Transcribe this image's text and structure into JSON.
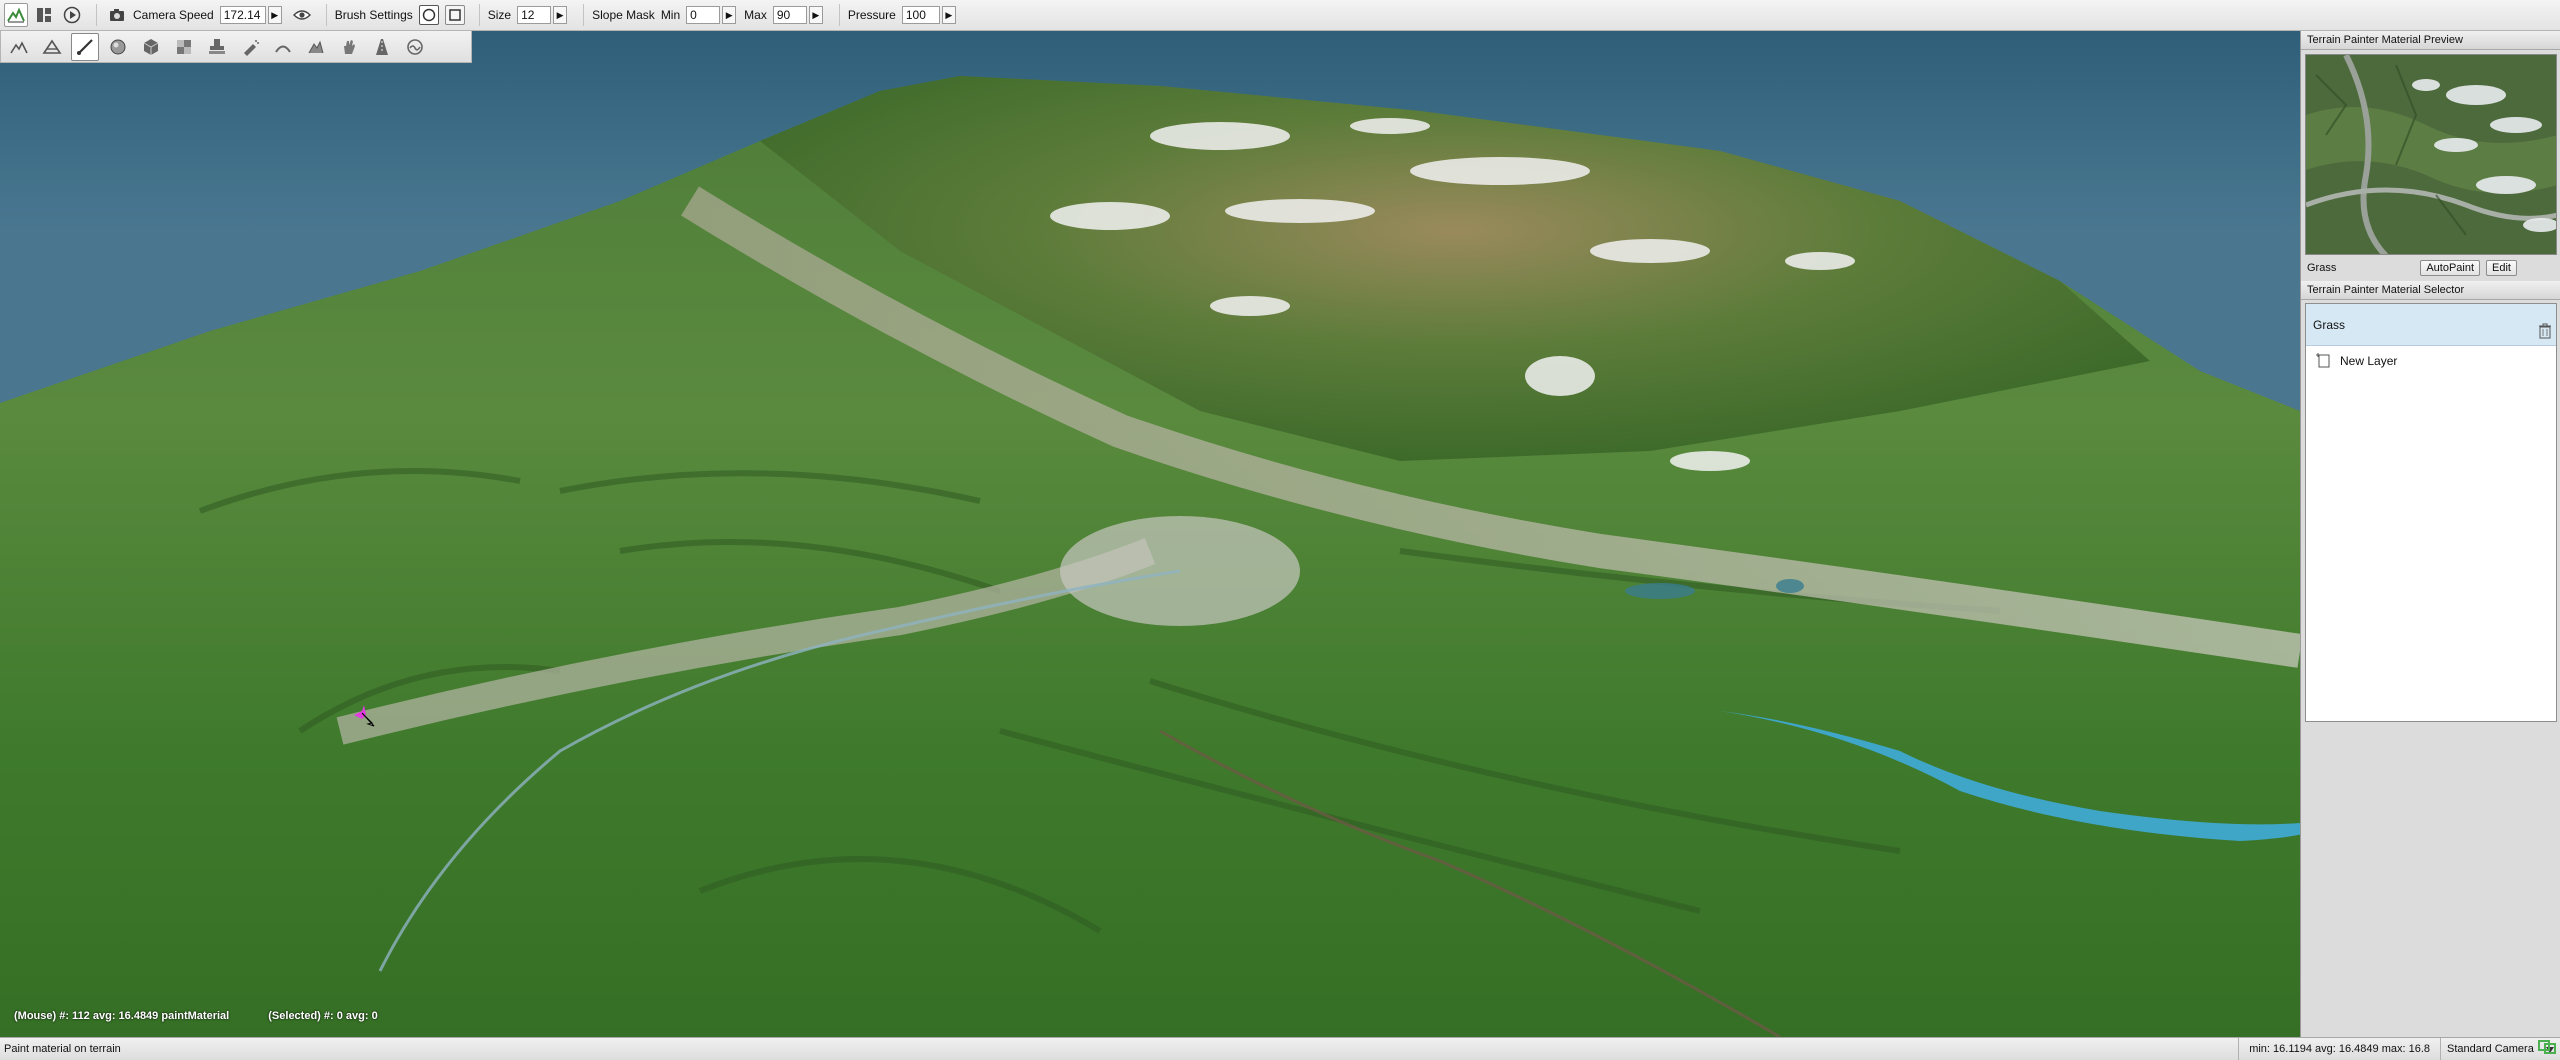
{
  "toolbar": {
    "camera_speed_label": "Camera Speed",
    "camera_speed_value": "172.14",
    "brush_settings_label": "Brush Settings",
    "size_label": "Size",
    "size_value": "12",
    "slope_mask_label": "Slope Mask",
    "min_label": "Min",
    "min_value": "0",
    "max_label": "Max",
    "max_value": "90",
    "pressure_label": "Pressure",
    "pressure_value": "100",
    "brush_shape_selected": "circle"
  },
  "tools": [
    {
      "name": "raise-terrain-icon"
    },
    {
      "name": "flatten-terrain-icon"
    },
    {
      "name": "paint-brush-icon",
      "active": true
    },
    {
      "name": "sphere-icon"
    },
    {
      "name": "cube-icon"
    },
    {
      "name": "texture-icon"
    },
    {
      "name": "stamp-icon"
    },
    {
      "name": "spray-icon"
    },
    {
      "name": "smooth-icon"
    },
    {
      "name": "erode-icon"
    },
    {
      "name": "hand-icon"
    },
    {
      "name": "road-icon"
    },
    {
      "name": "river-icon"
    }
  ],
  "viewport": {
    "mouse_stats": "(Mouse) #: 112 avg: 16.4849 paintMaterial",
    "selected_stats": "(Selected) #: 0 avg: 0"
  },
  "preview": {
    "title": "Terrain Painter Material Preview",
    "material_name": "Grass",
    "autopaint_label": "AutoPaint",
    "edit_label": "Edit"
  },
  "selector": {
    "title": "Terrain Painter Material Selector",
    "material_name": "Grass",
    "new_layer_label": "New Layer"
  },
  "status": {
    "message": "Paint material on terrain",
    "minmax": "min: 16.1194 avg: 16.4849 max: 16.8",
    "camera": "Standard Camera"
  },
  "colors": {
    "sky": "#3f6f88",
    "selected_material_bg": "#d7e8f5",
    "cursor": "#e23be0"
  }
}
